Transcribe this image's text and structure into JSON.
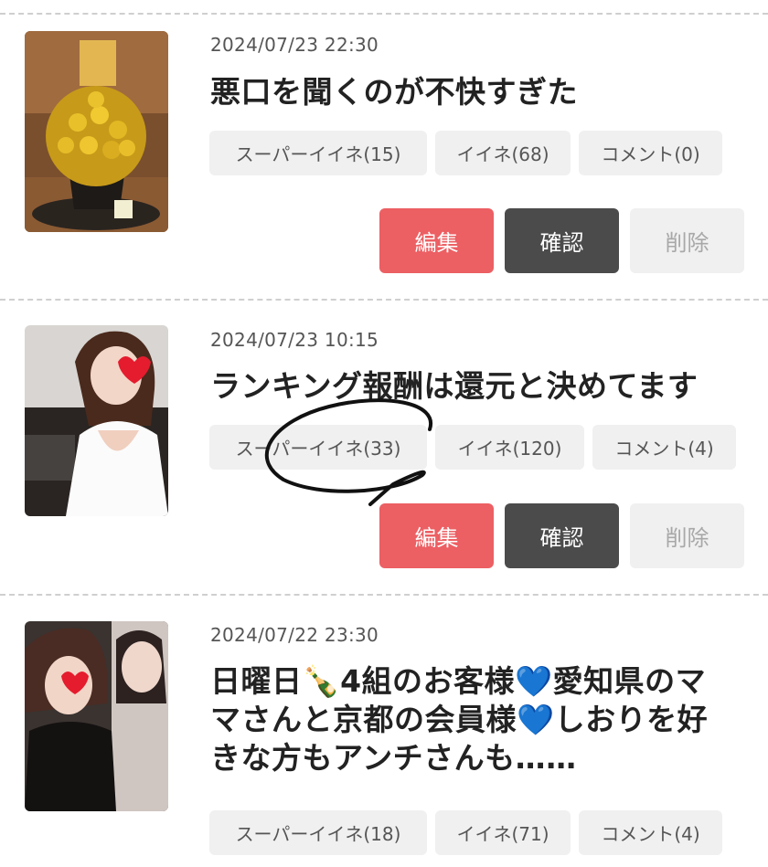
{
  "posts": [
    {
      "date": "2024/07/23 22:30",
      "title": "悪口を聞くのが不快すぎた",
      "super_like": "スーパーイイネ(15)",
      "like": "イイネ(68)",
      "comment": "コメント(0)",
      "edit": "編集",
      "confirm": "確認",
      "delete": "削除"
    },
    {
      "date": "2024/07/23 10:15",
      "title": "ランキング報酬は還元と決めてます",
      "super_like": "スーパーイイネ(33)",
      "like": "イイネ(120)",
      "comment": "コメント(4)",
      "edit": "編集",
      "confirm": "確認",
      "delete": "削除"
    },
    {
      "date": "2024/07/22 23:30",
      "title_line1": "日曜日🍾4組のお客様💙愛知県のマ",
      "title_line2": "マさんと京都の会員様💙しおりを好",
      "title_line3": "きな方もアンチさんも……",
      "super_like": "スーパーイイネ(18)",
      "like": "イイネ(71)",
      "comment": "コメント(4)"
    }
  ],
  "colors": {
    "edit": "#ec5f63",
    "confirm": "#4b4b4b",
    "delete_bg": "#f0f0f0",
    "chip_bg": "#f0f0f0"
  }
}
